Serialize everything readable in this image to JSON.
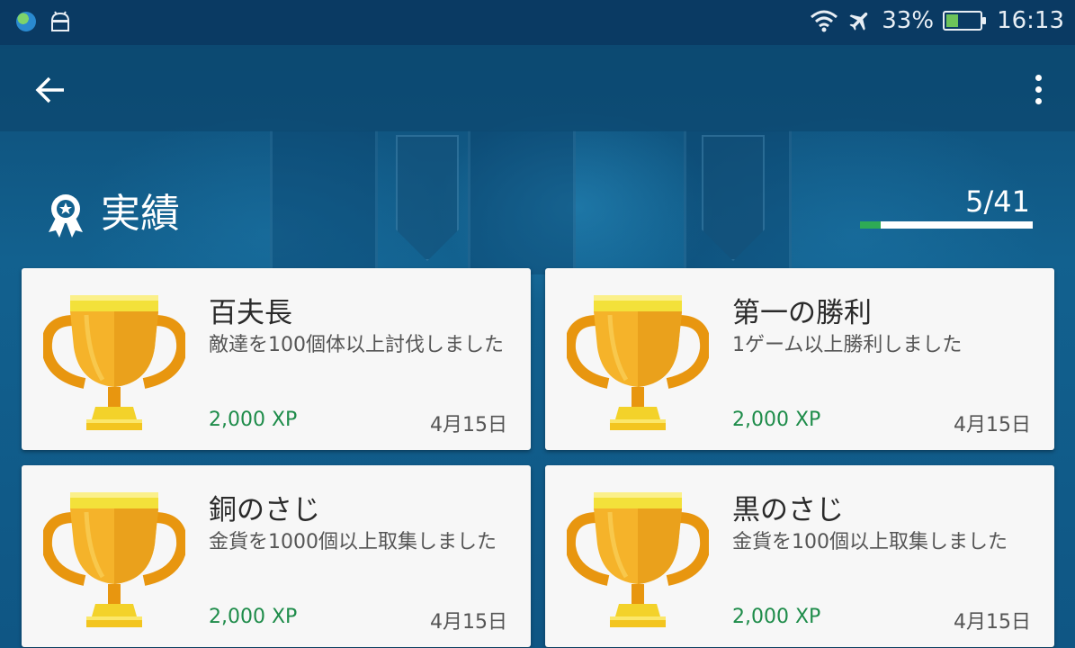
{
  "status_bar": {
    "battery": "33%",
    "time": "16:13",
    "icons": [
      "globe-icon",
      "android-icon",
      "wifi-icon",
      "airplane-icon",
      "battery-charging-icon"
    ]
  },
  "app_bar": {
    "back_icon": "arrow-left-icon",
    "menu_icon": "more-vert-icon"
  },
  "header": {
    "title": "実績",
    "progress_text": "5/41",
    "progress_fraction": 0.122,
    "progress_color": "#2eaa55"
  },
  "achievements": [
    {
      "title": "百夫長",
      "description": "敵達を100個体以上討伐しました",
      "xp": "2,000 XP",
      "date": "4月15日"
    },
    {
      "title": "第一の勝利",
      "description": "1ゲーム以上勝利しました",
      "xp": "2,000 XP",
      "date": "4月15日"
    },
    {
      "title": "銅のさじ",
      "description": "金貨を1000個以上取集しました",
      "xp": "2,000 XP",
      "date": "4月15日"
    },
    {
      "title": "黒のさじ",
      "description": "金貨を100個以上取集しました",
      "xp": "2,000 XP",
      "date": "4月15日"
    }
  ],
  "colors": {
    "xp": "#1e8c4a",
    "trophy": "#f5b32a"
  }
}
